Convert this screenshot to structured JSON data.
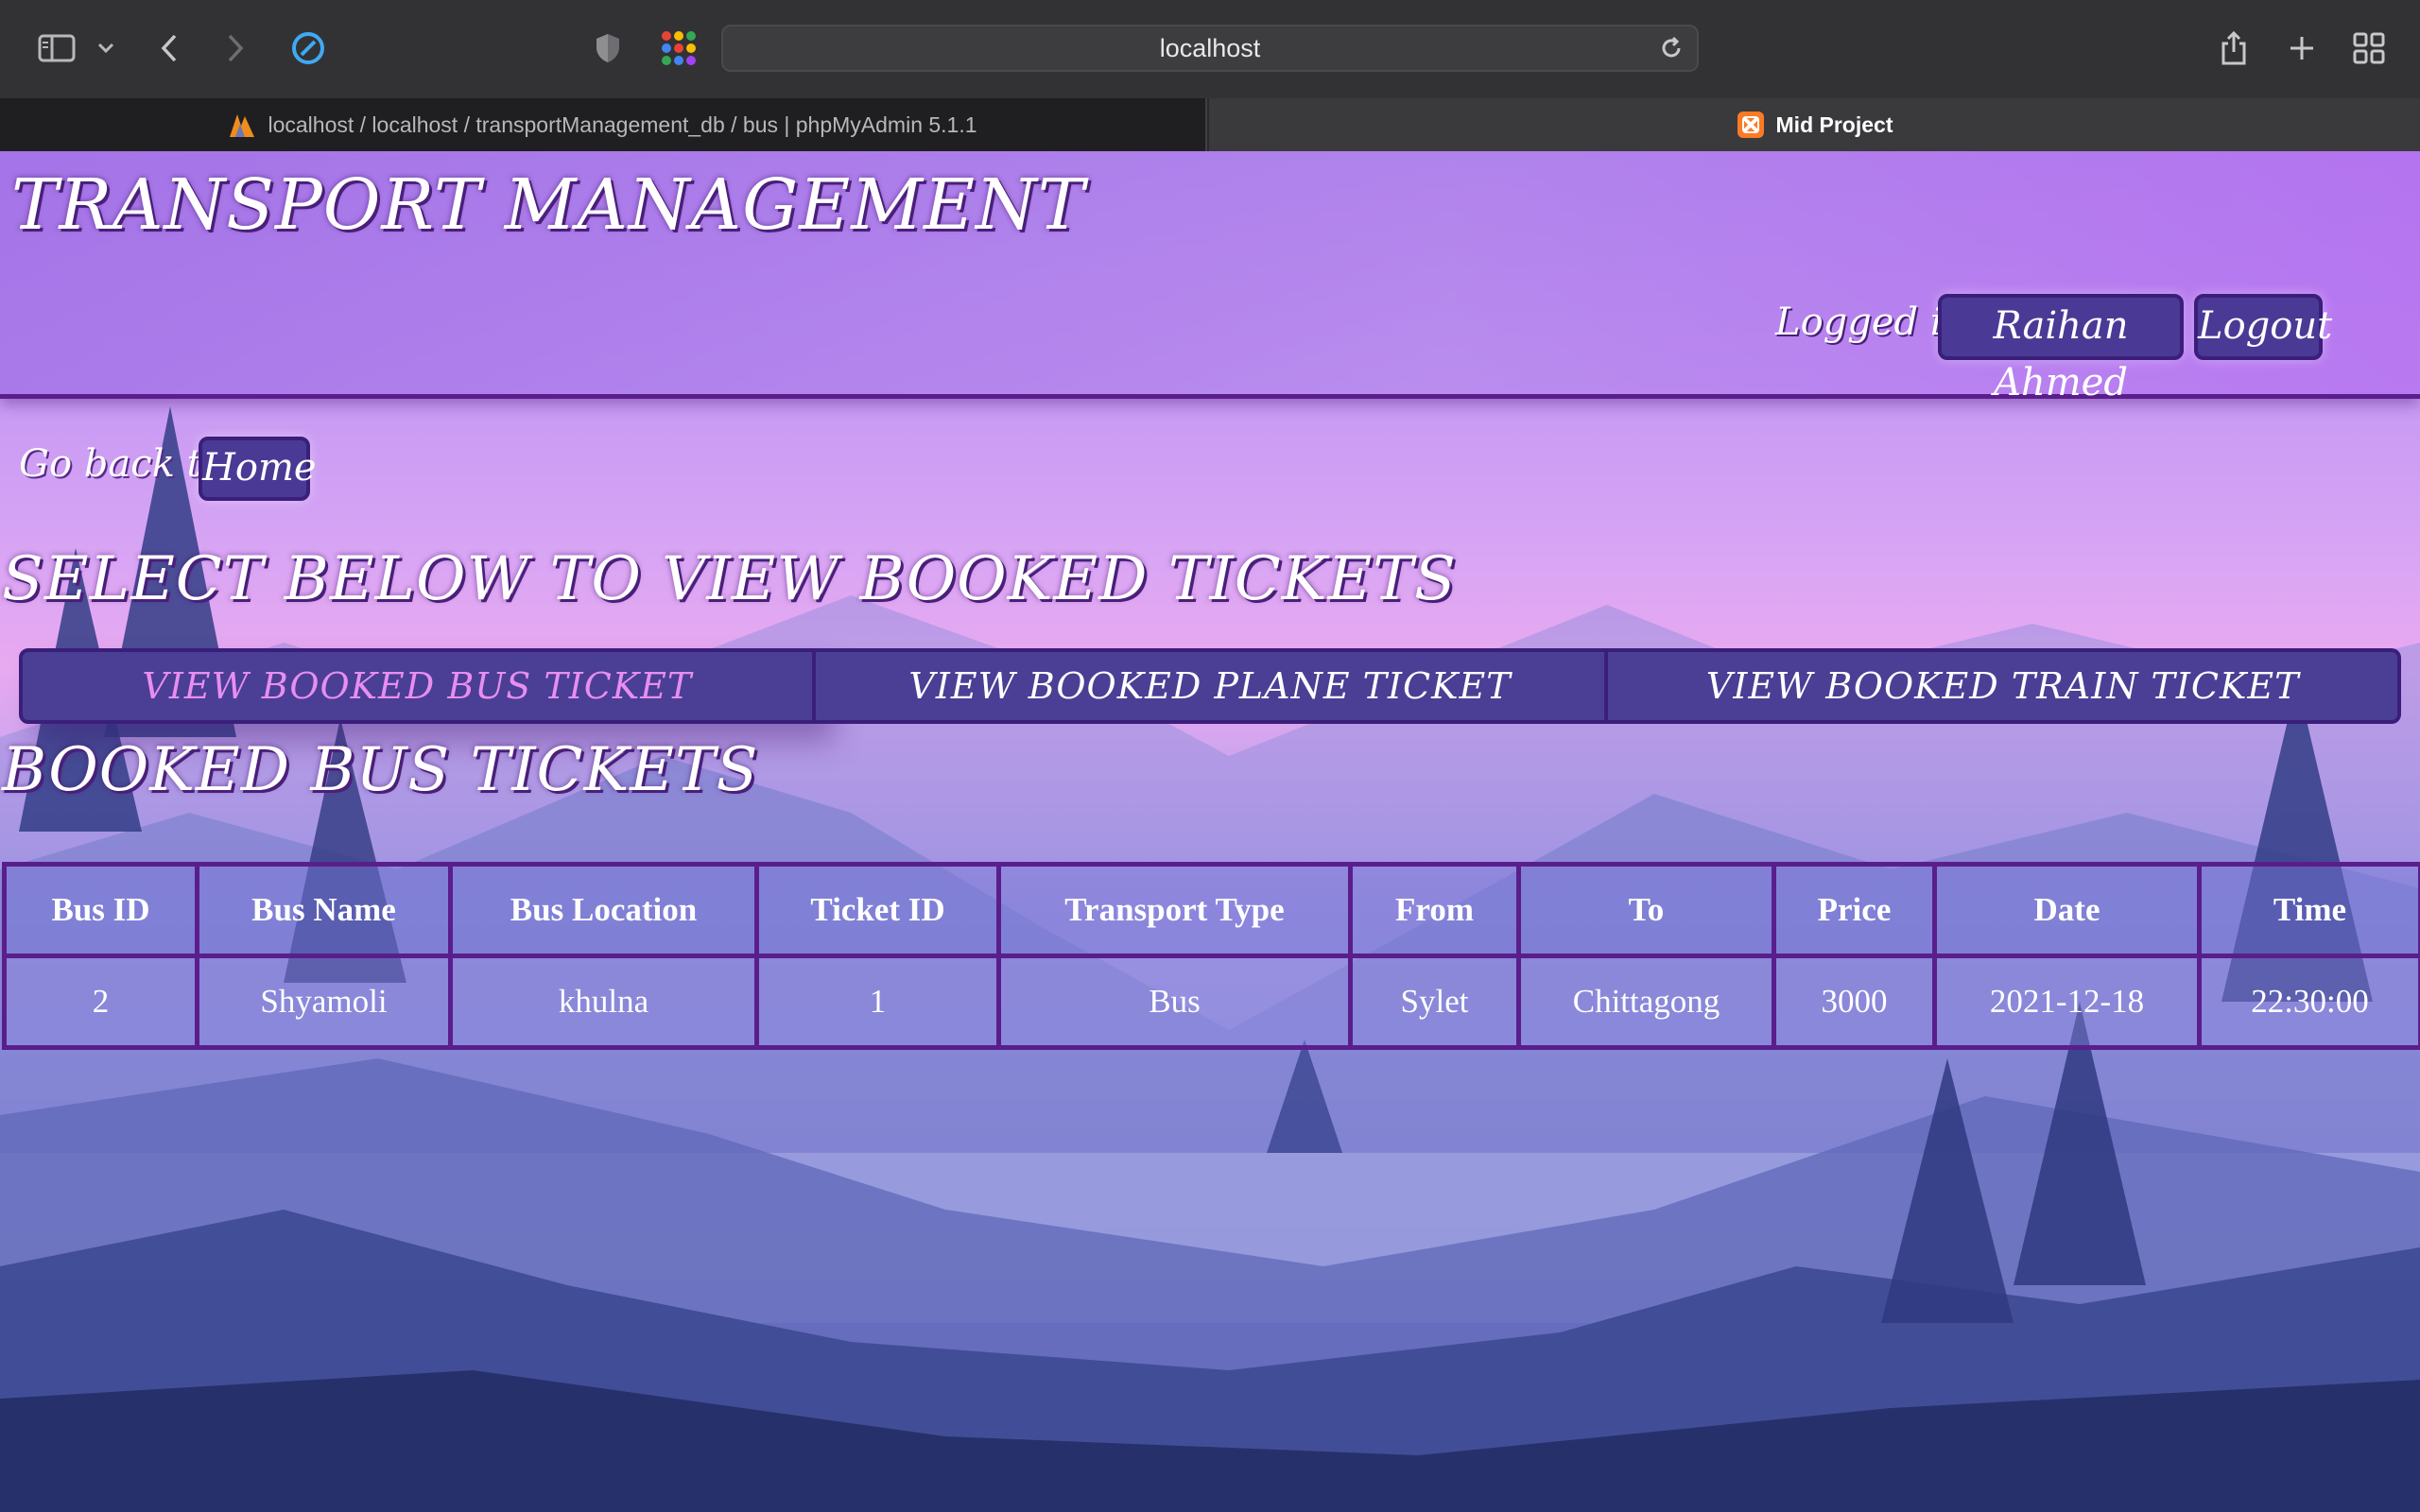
{
  "browser": {
    "url": "localhost",
    "tabs": [
      {
        "label": "localhost / localhost / transportManagement_db / bus | phpMyAdmin 5.1.1",
        "active": false
      },
      {
        "label": "Mid Project",
        "active": true
      }
    ],
    "icons": [
      "sidebar-icon",
      "chevron-down-icon",
      "back-icon",
      "forward-icon",
      "compass-icon",
      "shield-icon",
      "grid-dots-icon",
      "reload-icon",
      "share-icon",
      "plus-icon",
      "tabs-overview-icon"
    ]
  },
  "page": {
    "site_title": "TRANSPORT MANAGEMENT",
    "logged_in_label": "Logged in:",
    "user_name": "Raihan Ahmed",
    "logout_label": "Logout",
    "go_back_label": "Go back to :",
    "home_label": "Home",
    "select_heading": "SELECT BELOW TO VIEW BOOKED TICKETS",
    "ticket_tabs": [
      {
        "label": "VIEW BOOKED BUS TICKET",
        "active": true
      },
      {
        "label": "VIEW BOOKED PLANE TICKET",
        "active": false
      },
      {
        "label": "VIEW BOOKED TRAIN TICKET",
        "active": false
      }
    ],
    "table_heading": "BOOKED BUS TICKETS",
    "table": {
      "columns": [
        "Bus ID",
        "Bus Name",
        "Bus Location",
        "Ticket ID",
        "Transport Type",
        "From",
        "To",
        "Price",
        "Date",
        "Time"
      ],
      "rows": [
        [
          "2",
          "Shyamoli",
          "khulna",
          "1",
          "Bus",
          "Sylet",
          "Chittagong",
          "3000",
          "2021-12-18",
          "22:30:00"
        ]
      ]
    }
  },
  "colors": {
    "accent_border": "#5a1e8c",
    "button_fill": "#4a3f95",
    "active_tab_text": "#e88ef0"
  }
}
